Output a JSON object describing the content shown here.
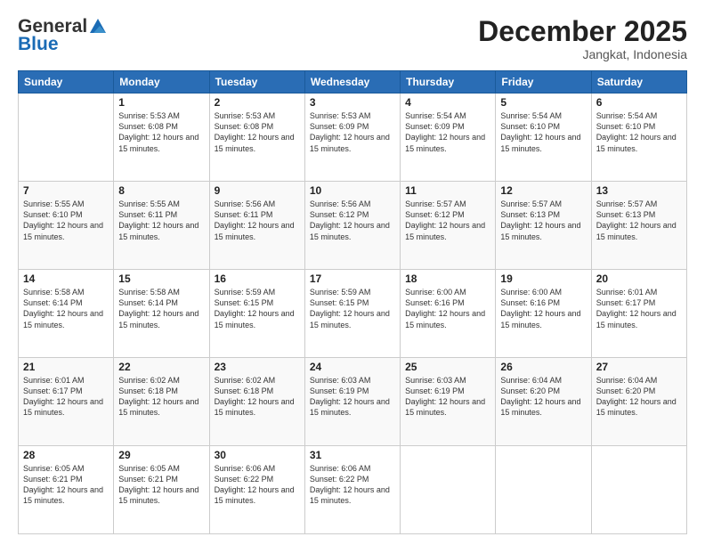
{
  "logo": {
    "general": "General",
    "blue": "Blue"
  },
  "header": {
    "month": "December 2025",
    "location": "Jangkat, Indonesia"
  },
  "weekdays": [
    "Sunday",
    "Monday",
    "Tuesday",
    "Wednesday",
    "Thursday",
    "Friday",
    "Saturday"
  ],
  "weeks": [
    [
      {
        "day": "",
        "sunrise": "",
        "sunset": "",
        "daylight": ""
      },
      {
        "day": "1",
        "sunrise": "Sunrise: 5:53 AM",
        "sunset": "Sunset: 6:08 PM",
        "daylight": "Daylight: 12 hours and 15 minutes."
      },
      {
        "day": "2",
        "sunrise": "Sunrise: 5:53 AM",
        "sunset": "Sunset: 6:08 PM",
        "daylight": "Daylight: 12 hours and 15 minutes."
      },
      {
        "day": "3",
        "sunrise": "Sunrise: 5:53 AM",
        "sunset": "Sunset: 6:09 PM",
        "daylight": "Daylight: 12 hours and 15 minutes."
      },
      {
        "day": "4",
        "sunrise": "Sunrise: 5:54 AM",
        "sunset": "Sunset: 6:09 PM",
        "daylight": "Daylight: 12 hours and 15 minutes."
      },
      {
        "day": "5",
        "sunrise": "Sunrise: 5:54 AM",
        "sunset": "Sunset: 6:10 PM",
        "daylight": "Daylight: 12 hours and 15 minutes."
      },
      {
        "day": "6",
        "sunrise": "Sunrise: 5:54 AM",
        "sunset": "Sunset: 6:10 PM",
        "daylight": "Daylight: 12 hours and 15 minutes."
      }
    ],
    [
      {
        "day": "7",
        "sunrise": "Sunrise: 5:55 AM",
        "sunset": "Sunset: 6:10 PM",
        "daylight": "Daylight: 12 hours and 15 minutes."
      },
      {
        "day": "8",
        "sunrise": "Sunrise: 5:55 AM",
        "sunset": "Sunset: 6:11 PM",
        "daylight": "Daylight: 12 hours and 15 minutes."
      },
      {
        "day": "9",
        "sunrise": "Sunrise: 5:56 AM",
        "sunset": "Sunset: 6:11 PM",
        "daylight": "Daylight: 12 hours and 15 minutes."
      },
      {
        "day": "10",
        "sunrise": "Sunrise: 5:56 AM",
        "sunset": "Sunset: 6:12 PM",
        "daylight": "Daylight: 12 hours and 15 minutes."
      },
      {
        "day": "11",
        "sunrise": "Sunrise: 5:57 AM",
        "sunset": "Sunset: 6:12 PM",
        "daylight": "Daylight: 12 hours and 15 minutes."
      },
      {
        "day": "12",
        "sunrise": "Sunrise: 5:57 AM",
        "sunset": "Sunset: 6:13 PM",
        "daylight": "Daylight: 12 hours and 15 minutes."
      },
      {
        "day": "13",
        "sunrise": "Sunrise: 5:57 AM",
        "sunset": "Sunset: 6:13 PM",
        "daylight": "Daylight: 12 hours and 15 minutes."
      }
    ],
    [
      {
        "day": "14",
        "sunrise": "Sunrise: 5:58 AM",
        "sunset": "Sunset: 6:14 PM",
        "daylight": "Daylight: 12 hours and 15 minutes."
      },
      {
        "day": "15",
        "sunrise": "Sunrise: 5:58 AM",
        "sunset": "Sunset: 6:14 PM",
        "daylight": "Daylight: 12 hours and 15 minutes."
      },
      {
        "day": "16",
        "sunrise": "Sunrise: 5:59 AM",
        "sunset": "Sunset: 6:15 PM",
        "daylight": "Daylight: 12 hours and 15 minutes."
      },
      {
        "day": "17",
        "sunrise": "Sunrise: 5:59 AM",
        "sunset": "Sunset: 6:15 PM",
        "daylight": "Daylight: 12 hours and 15 minutes."
      },
      {
        "day": "18",
        "sunrise": "Sunrise: 6:00 AM",
        "sunset": "Sunset: 6:16 PM",
        "daylight": "Daylight: 12 hours and 15 minutes."
      },
      {
        "day": "19",
        "sunrise": "Sunrise: 6:00 AM",
        "sunset": "Sunset: 6:16 PM",
        "daylight": "Daylight: 12 hours and 15 minutes."
      },
      {
        "day": "20",
        "sunrise": "Sunrise: 6:01 AM",
        "sunset": "Sunset: 6:17 PM",
        "daylight": "Daylight: 12 hours and 15 minutes."
      }
    ],
    [
      {
        "day": "21",
        "sunrise": "Sunrise: 6:01 AM",
        "sunset": "Sunset: 6:17 PM",
        "daylight": "Daylight: 12 hours and 15 minutes."
      },
      {
        "day": "22",
        "sunrise": "Sunrise: 6:02 AM",
        "sunset": "Sunset: 6:18 PM",
        "daylight": "Daylight: 12 hours and 15 minutes."
      },
      {
        "day": "23",
        "sunrise": "Sunrise: 6:02 AM",
        "sunset": "Sunset: 6:18 PM",
        "daylight": "Daylight: 12 hours and 15 minutes."
      },
      {
        "day": "24",
        "sunrise": "Sunrise: 6:03 AM",
        "sunset": "Sunset: 6:19 PM",
        "daylight": "Daylight: 12 hours and 15 minutes."
      },
      {
        "day": "25",
        "sunrise": "Sunrise: 6:03 AM",
        "sunset": "Sunset: 6:19 PM",
        "daylight": "Daylight: 12 hours and 15 minutes."
      },
      {
        "day": "26",
        "sunrise": "Sunrise: 6:04 AM",
        "sunset": "Sunset: 6:20 PM",
        "daylight": "Daylight: 12 hours and 15 minutes."
      },
      {
        "day": "27",
        "sunrise": "Sunrise: 6:04 AM",
        "sunset": "Sunset: 6:20 PM",
        "daylight": "Daylight: 12 hours and 15 minutes."
      }
    ],
    [
      {
        "day": "28",
        "sunrise": "Sunrise: 6:05 AM",
        "sunset": "Sunset: 6:21 PM",
        "daylight": "Daylight: 12 hours and 15 minutes."
      },
      {
        "day": "29",
        "sunrise": "Sunrise: 6:05 AM",
        "sunset": "Sunset: 6:21 PM",
        "daylight": "Daylight: 12 hours and 15 minutes."
      },
      {
        "day": "30",
        "sunrise": "Sunrise: 6:06 AM",
        "sunset": "Sunset: 6:22 PM",
        "daylight": "Daylight: 12 hours and 15 minutes."
      },
      {
        "day": "31",
        "sunrise": "Sunrise: 6:06 AM",
        "sunset": "Sunset: 6:22 PM",
        "daylight": "Daylight: 12 hours and 15 minutes."
      },
      {
        "day": "",
        "sunrise": "",
        "sunset": "",
        "daylight": ""
      },
      {
        "day": "",
        "sunrise": "",
        "sunset": "",
        "daylight": ""
      },
      {
        "day": "",
        "sunrise": "",
        "sunset": "",
        "daylight": ""
      }
    ]
  ]
}
